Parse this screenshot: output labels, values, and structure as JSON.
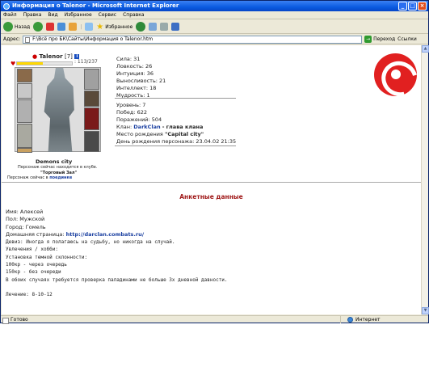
{
  "window": {
    "title": "Информация о Talenor - Microsoft Internet Explorer"
  },
  "menu": [
    "Файл",
    "Правка",
    "Вид",
    "Избранное",
    "Сервис",
    "Справка"
  ],
  "toolbar": {
    "back_label": "Назад",
    "favorites_label": "Избранное"
  },
  "address": {
    "label": "Адрес:",
    "value": "F:\\Всё про БК\\Сайты\\Информация о Talenor.htm",
    "go_label": "Переход",
    "links_label": "Ссылки"
  },
  "status": {
    "text": "Готово",
    "zone": "Интернет"
  },
  "profile": {
    "name": "Talenor",
    "level": "[7]",
    "hp_text": ": 113/237",
    "hp_fraction": 0.477,
    "city": "Demons city",
    "location_line1": "Персонаж сейчас находится в клубе.",
    "location_room": "\"Торговый Зал\"",
    "location_line3_prefix": "Персонаж сейчас в",
    "location_line3_link": "поединке",
    "stats": [
      "Сила: 31",
      "Ловкость: 26",
      "Интуиция: 36",
      "Выносливость: 21",
      "Интеллект: 18",
      "Мудрость: 1"
    ],
    "rank": "Уровень: 7",
    "wins": "Побед: 622",
    "losses": "Поражений: 504",
    "clan_prefix": "Клан:",
    "clan_name": "DarkClan",
    "clan_role": "- глава клана",
    "birthplace_prefix": "Место рождения",
    "birthplace": "\"Capital city\"",
    "birthday": "День рождения персонажа: 23.04.02 21:35"
  },
  "anket": {
    "title": "Анкетные данные",
    "name": "Имя: Алексей",
    "sex": "Пол: Мужской",
    "city": "Город: Гомель",
    "homepage_label": "Домашняя страница:",
    "homepage_url": "http://darclan.combats.ru/",
    "motto": "Девиз: Иногда я полагаюсь на судьбу, но никогда на случай.",
    "hobby_label": "Увлечения / хобби:",
    "hobby_lines": [
      "Установка темной склонности:",
      "100кр - через очередь",
      "150кр - без очереди",
      "В обоих случаях требуется проверка паладинами не больше 3х дневной давности."
    ],
    "healing": "Лечение: 8-10-12"
  }
}
